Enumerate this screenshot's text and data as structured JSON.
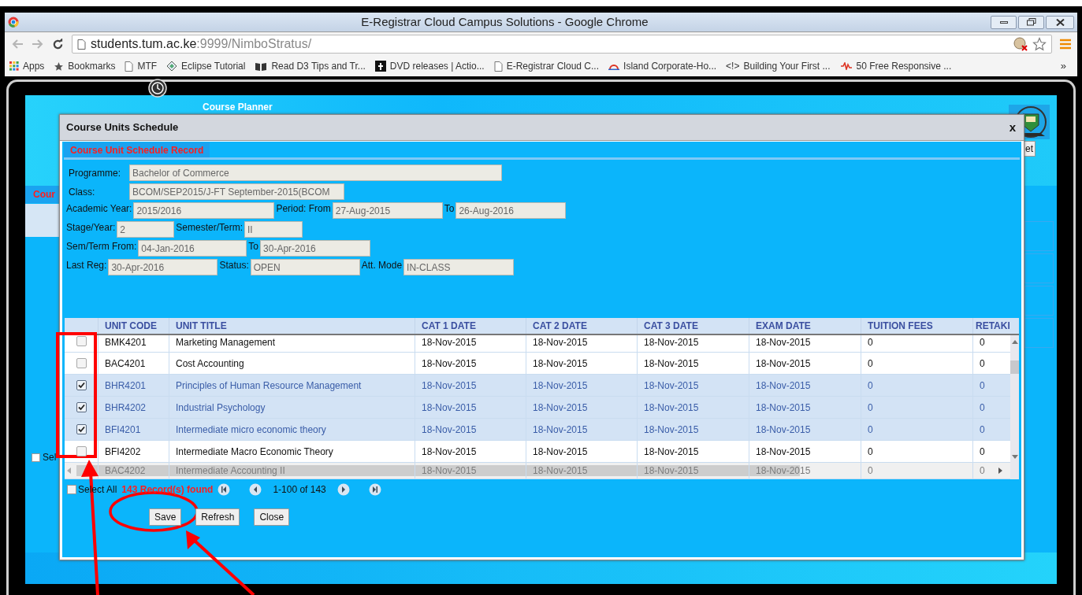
{
  "browser": {
    "title": "E-Registrar Cloud Campus Solutions - Google Chrome",
    "url_host": "students.tum.ac.ke",
    "url_path": ":9999/NimboStratus/",
    "more": "»",
    "bookmarks": [
      {
        "label": "Apps"
      },
      {
        "label": "Bookmarks"
      },
      {
        "label": "MTF"
      },
      {
        "label": "Eclipse Tutorial"
      },
      {
        "label": "Read D3 Tips and Tr..."
      },
      {
        "label": "DVD releases | Actio..."
      },
      {
        "label": "E-Registrar Cloud C..."
      },
      {
        "label": "Island Corporate-Ho..."
      },
      {
        "label": "Building Your First ...",
        "glyph": "<!>"
      },
      {
        "label": "50 Free Responsive ..."
      }
    ]
  },
  "app": {
    "header_title": "Course Planner",
    "tab_partial": "Cour",
    "button_partial": "et",
    "select_partial": "Sel"
  },
  "dialog": {
    "title": "Course Units Schedule",
    "close": "x",
    "section": "Course Unit Schedule Record",
    "form_rows": [
      [
        {
          "label": "Programme:",
          "value": "Bachelor of Commerce"
        }
      ],
      [
        {
          "label": "Class:",
          "value": "BCOM/SEP2015/J-FT September-2015(BCOM"
        }
      ],
      [
        {
          "label": "Academic Year:",
          "value": "2015/2016"
        },
        {
          "label": "Period: From",
          "value": "27-Aug-2015"
        },
        {
          "label": "To",
          "value": "26-Aug-2016"
        }
      ],
      [
        {
          "label": "Stage/Year:",
          "value": "2"
        },
        {
          "label": "Semester/Term:",
          "value": "II"
        }
      ],
      [
        {
          "label": "Sem/Term From:",
          "value": "04-Jan-2016"
        },
        {
          "label": "To",
          "value": "30-Apr-2016"
        }
      ],
      [
        {
          "label": "Last Reg:",
          "value": "30-Apr-2016"
        },
        {
          "label": "Status:",
          "value": "OPEN"
        },
        {
          "label": "Att. Mode",
          "value": "IN-CLASS"
        }
      ]
    ],
    "table": {
      "columns": [
        "UNIT CODE",
        "UNIT TITLE",
        "CAT 1 DATE",
        "CAT 2 DATE",
        "CAT 3 DATE",
        "EXAM DATE",
        "TUITION FEES",
        "RETAKI"
      ],
      "rows": [
        {
          "checked": false,
          "dimmed": false,
          "cells": [
            "BMK4201",
            "Marketing Management",
            "18-Nov-2015",
            "18-Nov-2015",
            "18-Nov-2015",
            "18-Nov-2015",
            "0",
            "0"
          ]
        },
        {
          "checked": false,
          "dimmed": false,
          "cells": [
            "BAC4201",
            "Cost Accounting",
            "18-Nov-2015",
            "18-Nov-2015",
            "18-Nov-2015",
            "18-Nov-2015",
            "0",
            "0"
          ]
        },
        {
          "checked": true,
          "dimmed": false,
          "cells": [
            "BHR4201",
            "Principles of Human Resource Management",
            "18-Nov-2015",
            "18-Nov-2015",
            "18-Nov-2015",
            "18-Nov-2015",
            "0",
            "0"
          ]
        },
        {
          "checked": true,
          "dimmed": false,
          "cells": [
            "BHR4202",
            "Industrial Psychology",
            "18-Nov-2015",
            "18-Nov-2015",
            "18-Nov-2015",
            "18-Nov-2015",
            "0",
            "0"
          ]
        },
        {
          "checked": true,
          "dimmed": false,
          "cells": [
            "BFI4201",
            "Intermediate micro economic theory",
            "18-Nov-2015",
            "18-Nov-2015",
            "18-Nov-2015",
            "18-Nov-2015",
            "0",
            "0"
          ]
        },
        {
          "checked": false,
          "dimmed": false,
          "cells": [
            "BFI4202",
            "Intermediate Macro Economic Theory",
            "18-Nov-2015",
            "18-Nov-2015",
            "18-Nov-2015",
            "18-Nov-2015",
            "0",
            "0"
          ]
        },
        {
          "dimmed": true,
          "cells": [
            "BAC4202",
            "Intermediate Accounting II",
            "18-Nov-2015",
            "18-Nov-2015",
            "18-Nov-2015",
            "18-Nov-2015",
            "0",
            "0"
          ]
        }
      ]
    },
    "select_all": {
      "label": "Select All",
      "checked": false
    },
    "records": "143 Record(s) found",
    "page_range": "1-100 of 143",
    "buttons": [
      "Save",
      "Refresh",
      "Close"
    ]
  }
}
